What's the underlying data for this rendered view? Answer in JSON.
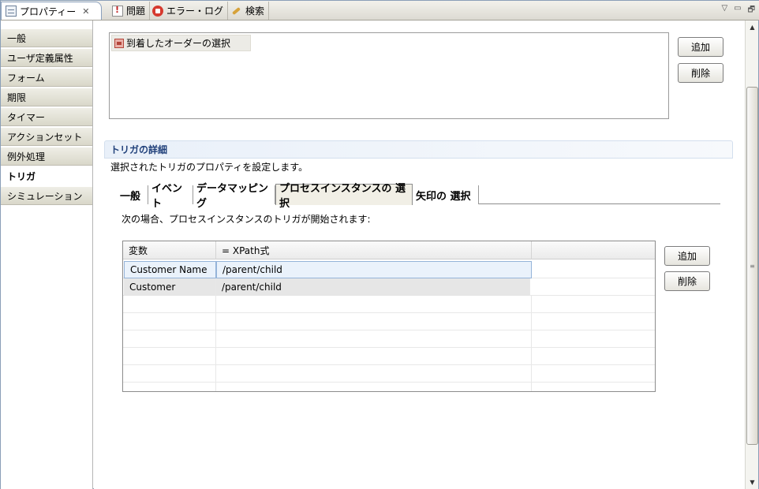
{
  "view_tabs": {
    "active": {
      "label": "プロパティー",
      "icon": "properties-icon"
    },
    "others": [
      {
        "label": "問題",
        "icon": "problems-icon"
      },
      {
        "label": "エラー・ログ",
        "icon": "error-log-icon"
      },
      {
        "label": "検索",
        "icon": "search-icon"
      }
    ]
  },
  "view_controls": {
    "menu": "▽",
    "minimize": "▭",
    "maximize": "🗗"
  },
  "sidebar": {
    "items": [
      {
        "label": "一般"
      },
      {
        "label": "ユーザ定義属性"
      },
      {
        "label": "フォーム"
      },
      {
        "label": "期限"
      },
      {
        "label": "タイマー"
      },
      {
        "label": "アクションセット"
      },
      {
        "label": "例外処理"
      },
      {
        "label": "トリガ",
        "active": true
      },
      {
        "label": "シミュレーション"
      }
    ]
  },
  "triggers": {
    "items": [
      {
        "label": "到着したオーダーの選択"
      }
    ],
    "add_label": "追加",
    "delete_label": "削除"
  },
  "details": {
    "title": "トリガの詳細",
    "description": "選択されたトリガのプロパティを設定します。",
    "tabs": [
      {
        "label": "一般"
      },
      {
        "label": "イベント"
      },
      {
        "label": "データマッピング"
      },
      {
        "label": "プロセスインスタンスの 選択",
        "active": true
      },
      {
        "label": "矢印の 選択"
      }
    ],
    "condition_label": "次の場合、プロセスインスタンスのトリガが開始されます:",
    "table": {
      "headers": [
        "変数",
        "= XPath式",
        ""
      ],
      "rows": [
        {
          "variable": "Customer Name",
          "xpath": "/parent/child",
          "selected": true
        },
        {
          "variable": "Customer",
          "xpath": "/parent/child"
        }
      ]
    },
    "add_label": "追加",
    "delete_label": "削除"
  },
  "scrollbar": {
    "up": "▲",
    "down": "▼",
    "grip": "≡"
  }
}
